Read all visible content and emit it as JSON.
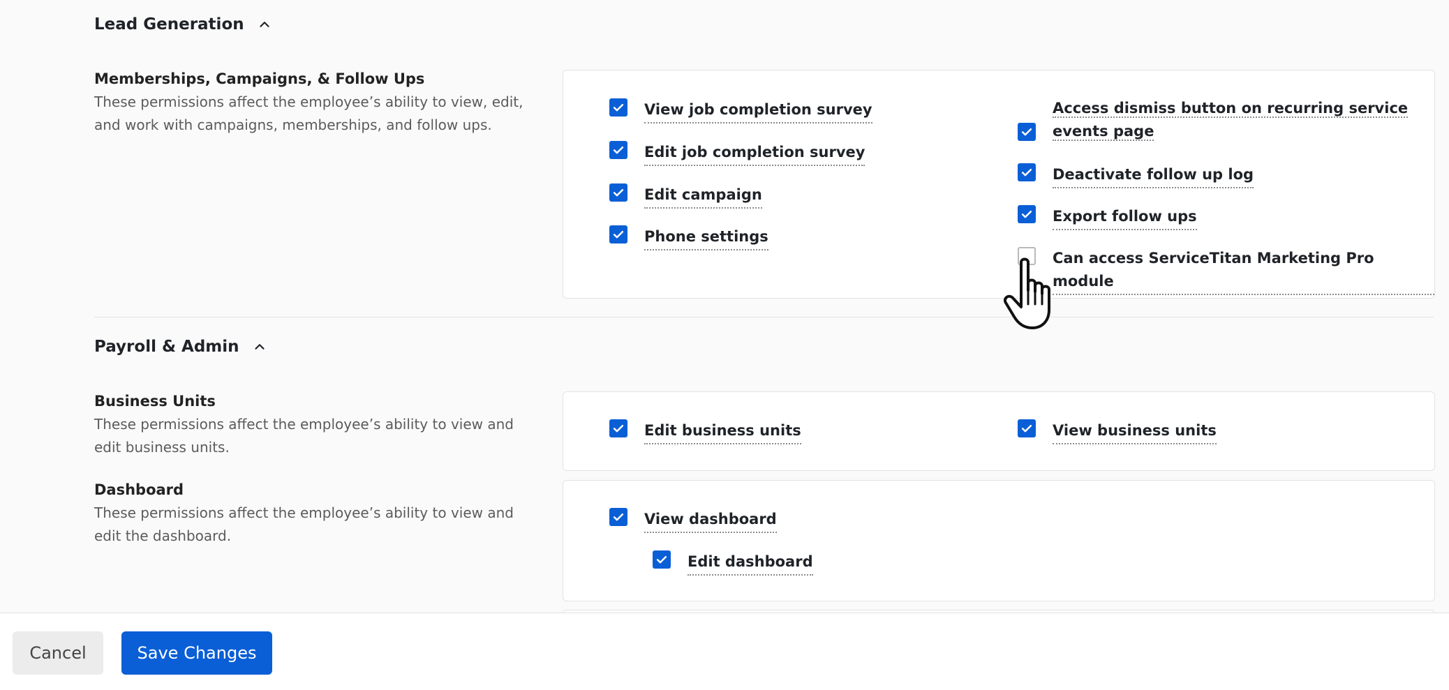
{
  "lead_generation": {
    "title": "Lead Generation",
    "groups": [
      {
        "title": "Memberships, Campaigns, & Follow Ups",
        "desc_line1": "These permissions affect the employee’s ability to view, edit,",
        "desc_line2": "and work with campaigns, memberships, and follow ups.",
        "left": [
          {
            "label": "View job completion survey",
            "checked": true
          },
          {
            "label": "Edit job completion survey",
            "checked": true
          },
          {
            "label": "Edit campaign",
            "checked": true
          },
          {
            "label": "Phone settings",
            "checked": true
          }
        ],
        "right": [
          {
            "label_line1": "Access dismiss button on recurring service",
            "label_line2": "events page",
            "checked": true
          },
          {
            "label": "Deactivate follow up log",
            "checked": true
          },
          {
            "label": "Export follow ups",
            "checked": true
          },
          {
            "label": "Can access ServiceTitan Marketing Pro module",
            "checked": false
          }
        ]
      }
    ]
  },
  "payroll_admin": {
    "title": "Payroll & Admin",
    "business_units": {
      "title": "Business Units",
      "desc_line1": "These permissions affect the employee’s ability to view and",
      "desc_line2": "edit business units.",
      "left": {
        "label": "Edit business units",
        "checked": true
      },
      "right": {
        "label": "View business units",
        "checked": true
      }
    },
    "dashboard": {
      "title": "Dashboard",
      "desc_line1": "These permissions affect the employee’s ability to view and",
      "desc_line2": "edit the dashboard.",
      "parent": {
        "label": "View dashboard",
        "checked": true
      },
      "child": {
        "label": "Edit dashboard",
        "checked": true
      }
    }
  },
  "footer": {
    "cancel_label": "Cancel",
    "save_label": "Save Changes"
  },
  "colors": {
    "accent": "#0a5fd6",
    "background": "#fafafa"
  },
  "icons": [
    "chevron-up-icon",
    "checkmark-icon",
    "hand-pointer-cursor-icon"
  ]
}
